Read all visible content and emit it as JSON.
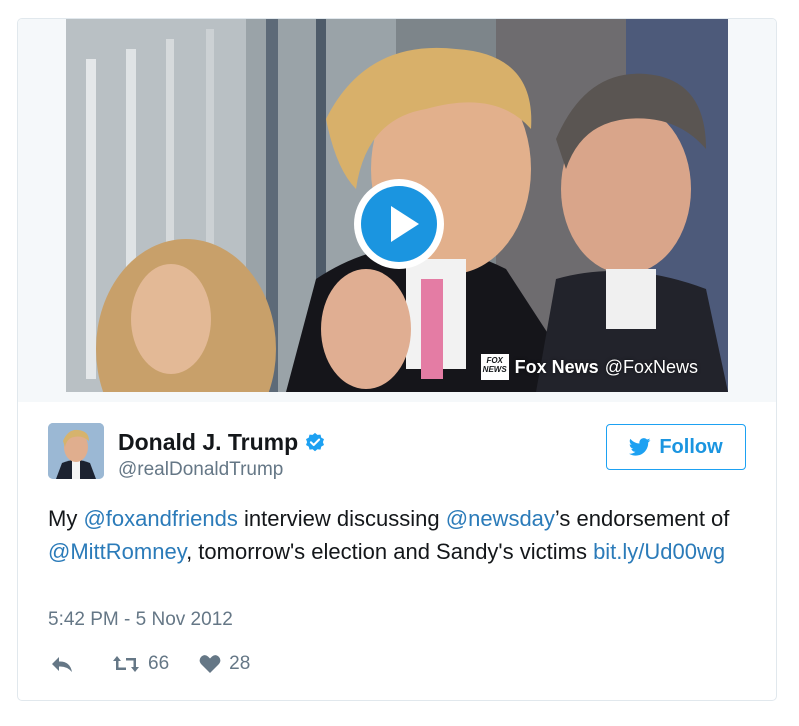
{
  "media": {
    "source_name": "Fox News",
    "source_handle": "@FoxNews",
    "source_logo_text": "FOX NEWS"
  },
  "user": {
    "name": "Donald J. Trump",
    "handle": "@realDonaldTrump"
  },
  "follow_label": "Follow",
  "tweet": {
    "t1": "My ",
    "mention1": "@foxandfriends",
    "t2": " interview discussing ",
    "mention2": "@newsday",
    "t3": "’s endorsement of ",
    "mention3": "@MittRomney",
    "t4": ", tomorrow's election and Sandy's victims ",
    "link": "bit.ly/Ud00wg"
  },
  "timestamp": "5:42 PM - 5 Nov 2012",
  "stats": {
    "retweets": "66",
    "likes": "28"
  },
  "icons": {
    "play": "play-icon",
    "verified": "verified-badge-icon",
    "bird": "twitter-bird-icon",
    "reply": "reply-icon",
    "retweet": "retweet-icon",
    "like": "heart-icon"
  },
  "colors": {
    "accent": "#1da1f2",
    "link": "#2b7bb9",
    "muted": "#657786",
    "play": "#1b95e0"
  }
}
